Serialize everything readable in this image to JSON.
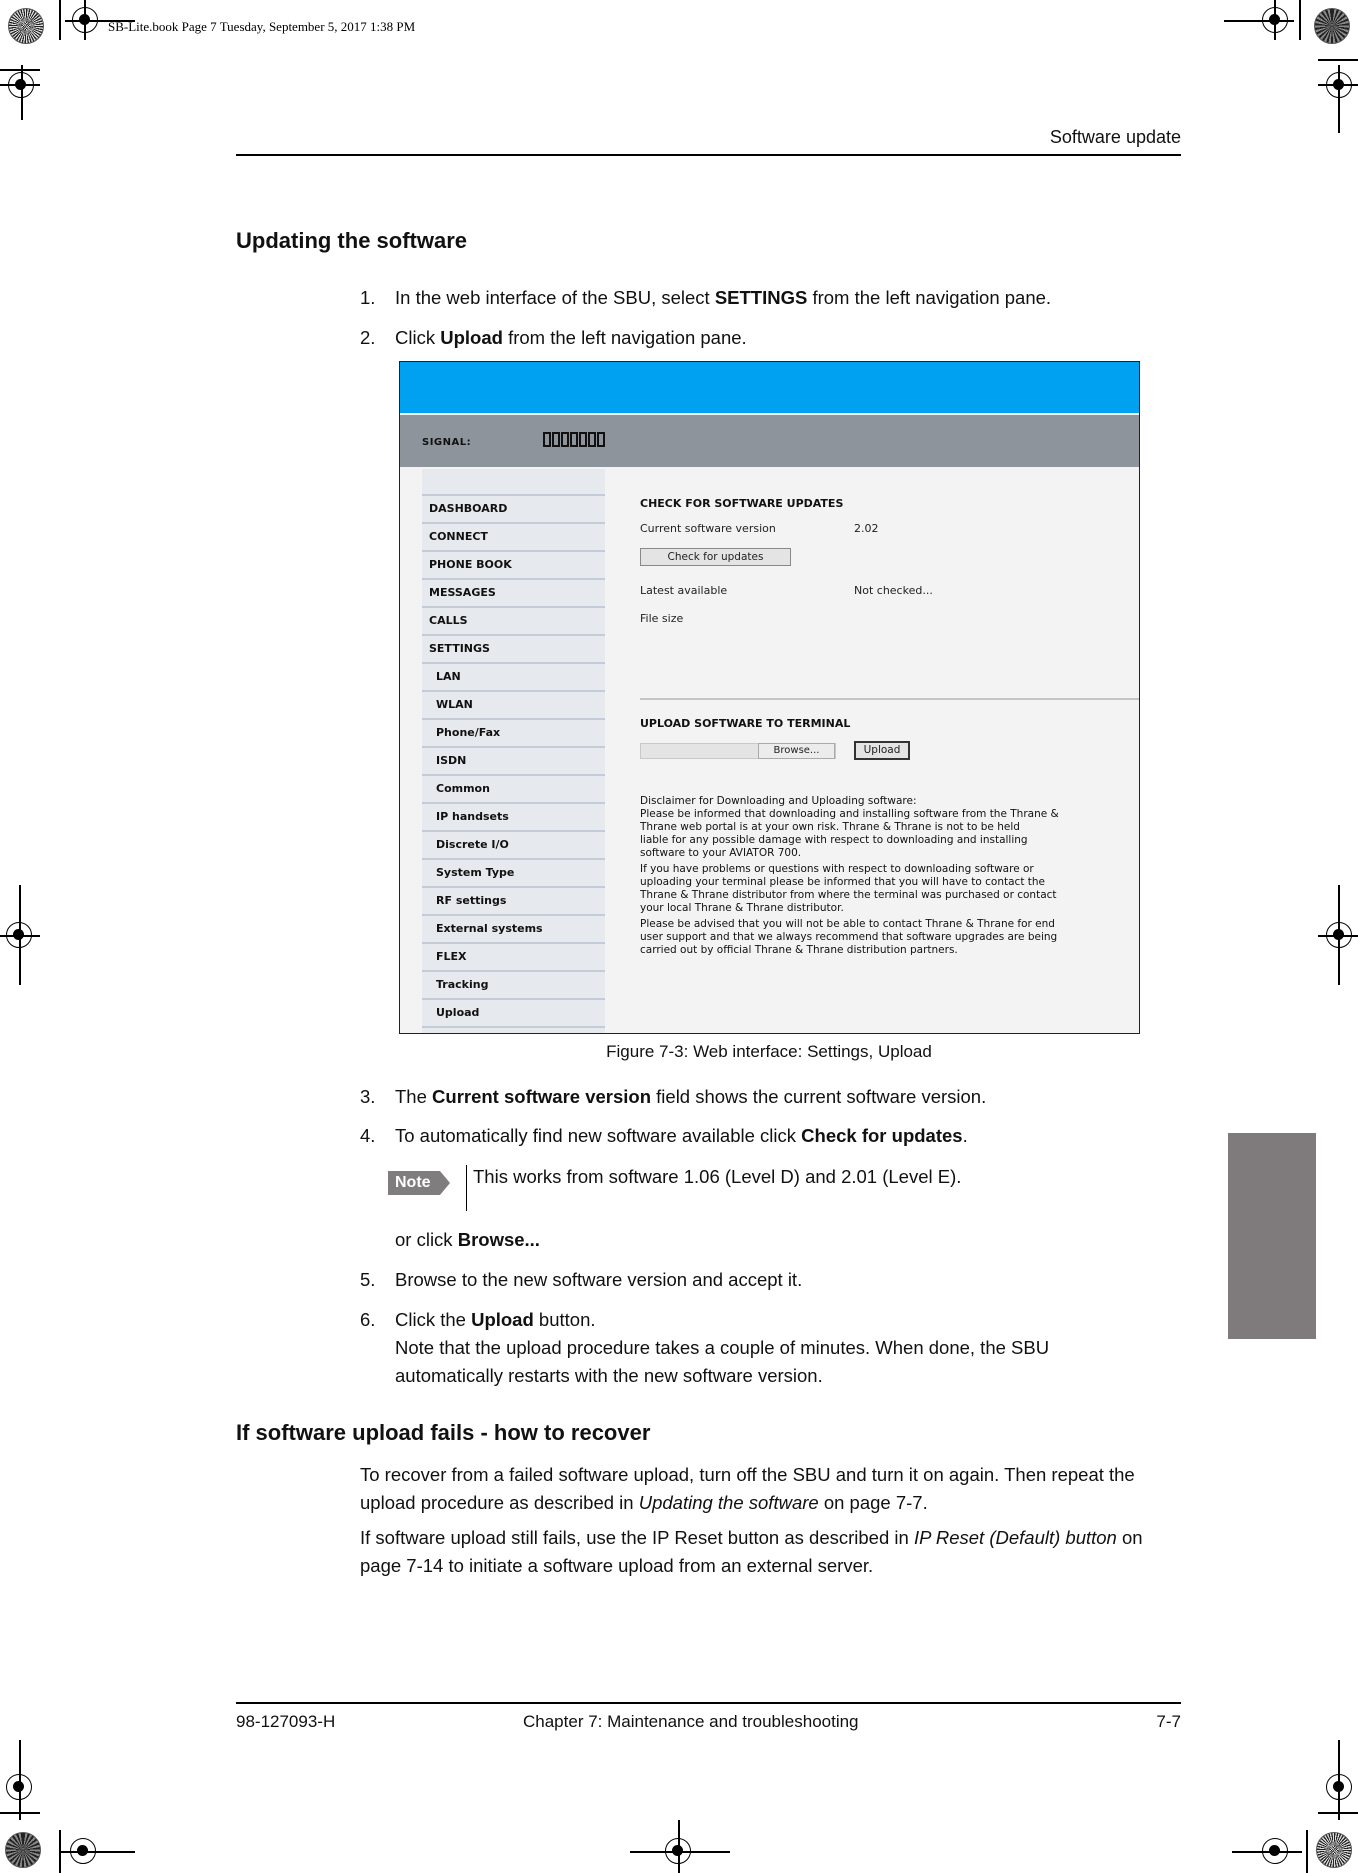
{
  "slug": "SB-Lite.book  Page 7  Tuesday, September 5, 2017  1:38 PM",
  "running_head": "Software update",
  "section1": {
    "title": "Updating the software",
    "steps": [
      {
        "num": "1.",
        "pre": "In the web interface of the SBU, select ",
        "bold": "SETTINGS",
        "post": " from the left navigation pane."
      },
      {
        "num": "2.",
        "pre": "Click ",
        "bold": "Upload",
        "post": " from the left navigation pane."
      },
      {
        "num": "3.",
        "pre": "The ",
        "bold": "Current software version",
        "post": " field shows the current software version."
      },
      {
        "num": "4.",
        "pre": "To automatically find new software available click ",
        "bold": "Check for updates",
        "post": "."
      },
      {
        "num": "5.",
        "pre": "Browse to the new software version and accept it.",
        "bold": "",
        "post": ""
      },
      {
        "num": "6.",
        "pre": "Click the ",
        "bold": "Upload",
        "post": " button."
      }
    ],
    "step6_note": "Note that the upload procedure takes a couple of minutes. When done, the SBU automatically restarts with the new software version.",
    "or_click": {
      "pre": "or click ",
      "bold": "Browse..."
    },
    "note": {
      "badge": "Note",
      "text": "This works from software 1.06 (Level D) and 2.01 (Level E)."
    }
  },
  "figure": {
    "caption": "Figure 7-3: Web interface: Settings, Upload",
    "signal_label": "SIGNAL:",
    "signal_bars": 7,
    "colors": {
      "header": "#00a1f1",
      "bar": "#8d949c",
      "nav": "#e6e9ee"
    },
    "nav": [
      "DASHBOARD",
      "CONNECT",
      "PHONE BOOK",
      "MESSAGES",
      "CALLS",
      "SETTINGS"
    ],
    "subnav": [
      "LAN",
      "WLAN",
      "Phone/Fax",
      "ISDN",
      "Common",
      "IP handsets",
      "Discrete I/O",
      "System Type",
      "RF settings",
      "External systems",
      "FLEX",
      "Tracking",
      "Upload"
    ],
    "check": {
      "title": "CHECK FOR SOFTWARE UPDATES",
      "current_label": "Current software version",
      "current_value": "2.02",
      "button": "Check for updates",
      "latest_label": "Latest available",
      "latest_value": "Not checked...",
      "size_label": "File size"
    },
    "upload": {
      "title": "UPLOAD SOFTWARE TO TERMINAL",
      "browse": "Browse...",
      "button": "Upload",
      "disclaimer1": "Disclaimer for Downloading and Uploading software:\nPlease be informed that downloading and installing software from the Thrane &\nThrane web portal is at your own risk. Thrane & Thrane is not to be held\nliable for any possible damage with respect to downloading and installing\nsoftware to your AVIATOR 700.",
      "disclaimer2": "If you have problems or questions with respect to downloading software or\nuploading your terminal please be informed that you will have to contact the\nThrane & Thrane distributor from where the terminal was purchased or contact\nyour local Thrane & Thrane distributor.",
      "disclaimer3": "Please be advised that you will not be able to contact Thrane & Thrane for end\nuser support and that we always recommend that software upgrades are being\ncarried out by official Thrane & Thrane distribution partners."
    }
  },
  "section2": {
    "title": "If software upload fails - how to recover",
    "p1": {
      "pre": "To recover from a failed software upload, turn off the SBU and turn it on again. Then repeat the upload procedure as described in ",
      "italic": "Updating the software",
      "post": " on page 7-7."
    },
    "p2": {
      "pre": "If software upload still fails, use the IP Reset button as described in ",
      "italic": "IP Reset (Default) button",
      "post": " on page 7-14 to initiate a software upload from an external server."
    }
  },
  "footer": {
    "doc_number": "98-127093-H",
    "chapter": "Chapter 7:  Maintenance and troubleshooting",
    "page": "7-7"
  }
}
